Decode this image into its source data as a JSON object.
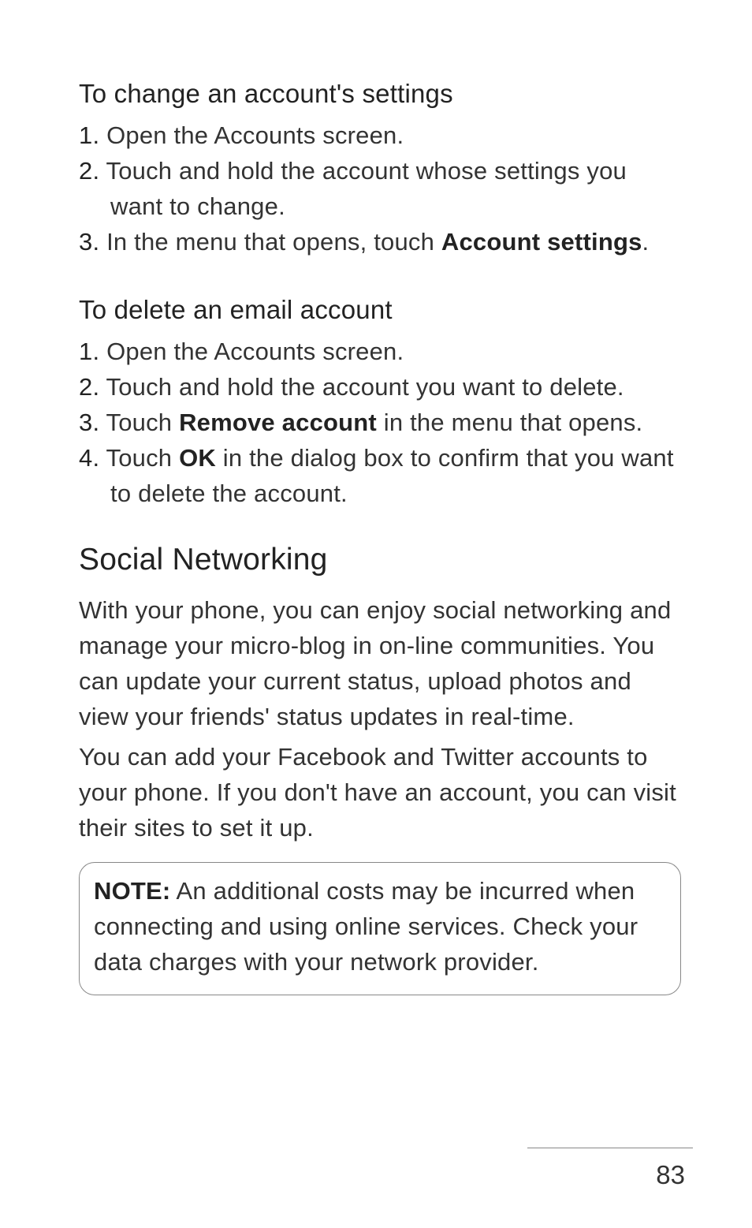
{
  "section1": {
    "heading": "To change an account's settings",
    "items": [
      {
        "num": "1.",
        "parts": [
          {
            "t": " Open the Accounts screen.",
            "b": false
          }
        ]
      },
      {
        "num": "2.",
        "parts": [
          {
            "t": " Touch and hold the account whose settings you want to change.",
            "b": false
          }
        ]
      },
      {
        "num": "3.",
        "parts": [
          {
            "t": " In the menu that opens, touch ",
            "b": false
          },
          {
            "t": "Account settings",
            "b": true
          },
          {
            "t": ".",
            "b": false
          }
        ]
      }
    ]
  },
  "section2": {
    "heading": "To delete an email account",
    "items": [
      {
        "num": "1.",
        "parts": [
          {
            "t": " Open the Accounts screen.",
            "b": false
          }
        ]
      },
      {
        "num": "2.",
        "parts": [
          {
            "t": " Touch and hold the account you want to delete.",
            "b": false
          }
        ]
      },
      {
        "num": "3.",
        "parts": [
          {
            "t": " Touch ",
            "b": false
          },
          {
            "t": "Remove account",
            "b": true
          },
          {
            "t": " in the menu that opens.",
            "b": false
          }
        ]
      },
      {
        "num": "4.",
        "parts": [
          {
            "t": " Touch ",
            "b": false
          },
          {
            "t": "OK",
            "b": true
          },
          {
            "t": " in the dialog box to confirm that you want to delete the account.",
            "b": false
          }
        ]
      }
    ]
  },
  "section3": {
    "heading": "Social Networking",
    "para1": "With your phone, you can enjoy social networking and manage your micro-blog in on-line communities. You can update your current status, upload photos and view your friends' status updates in real-time.",
    "para2": "You can add your Facebook and Twitter accounts to your phone. If you don't have an account, you can visit their sites to set it up."
  },
  "note": {
    "label": "NOTE:",
    "text": " An additional costs may be incurred when connecting and using online services. Check your data charges with your network provider."
  },
  "pageNumber": "83"
}
